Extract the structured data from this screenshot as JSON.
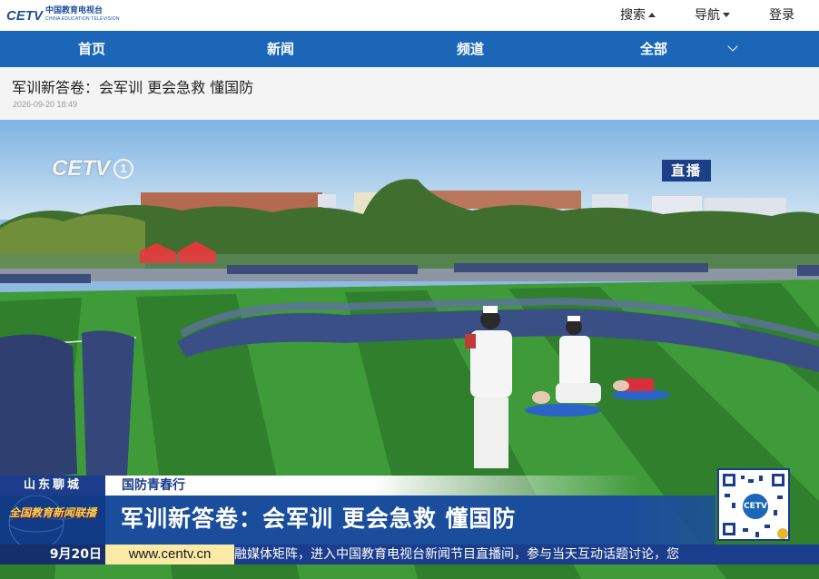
{
  "header": {
    "logo_mark": "CETV",
    "logo_cn": "中国教育电视台",
    "logo_en": "CHINA EDUCATION TELEVISION",
    "links": [
      "搜索",
      "导航",
      "登录"
    ]
  },
  "nav": {
    "items": [
      "首页",
      "新闻",
      "频道",
      "全部"
    ]
  },
  "article": {
    "title": "军训新答卷：会军训 更会急救 懂国防",
    "date": "2026-09-20 18:49"
  },
  "video": {
    "channel_logo": "CETV",
    "channel_number": "1",
    "live_badge": "直播",
    "location": "山东聊城",
    "tag": "国防青春行",
    "program_name": "全国教育新闻联播",
    "headline": "军训新答卷：会军训 更会急救 懂国防",
    "date": "9月20日",
    "url": "www.centv.cn",
    "ticker": "融媒体矩阵，进入中国教育电视台新闻节目直播间，参与当天互动话题讨论，您"
  },
  "colors": {
    "nav_blue": "#1c66b8",
    "caption_blue": "#1b3d8c",
    "url_bg": "#fbe9a6",
    "field_green": "#3f9a3a"
  },
  "icons": [
    "caret-up-icon",
    "caret-down-icon",
    "chevron-down-icon",
    "qr-code-icon"
  ]
}
